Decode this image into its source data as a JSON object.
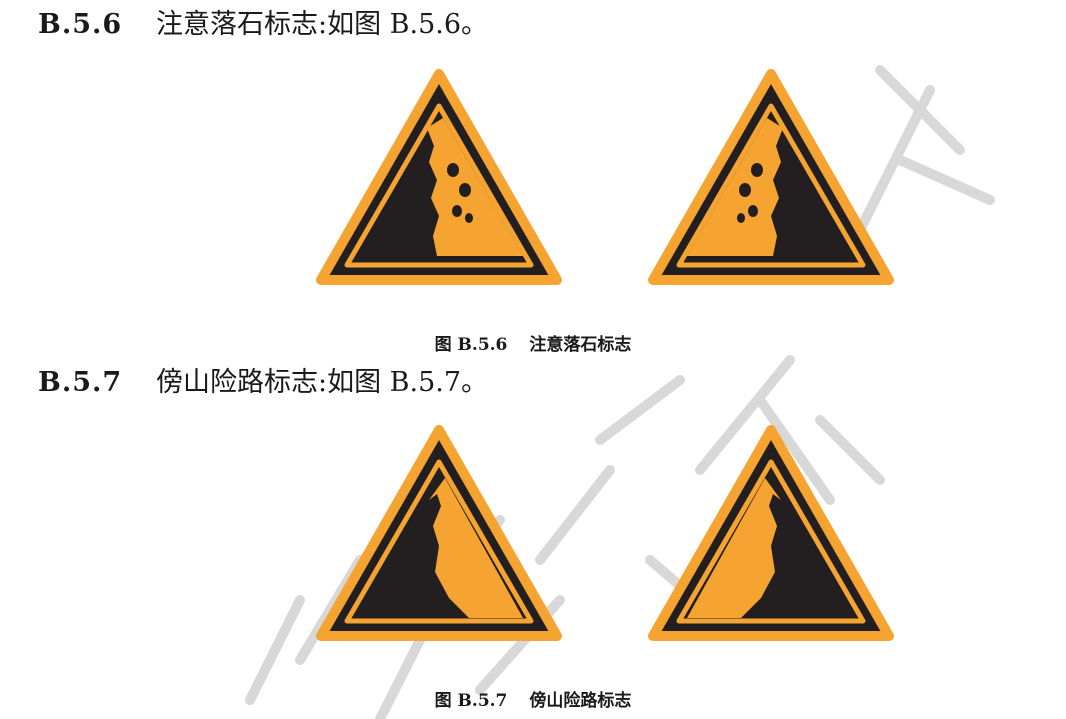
{
  "sections": [
    {
      "number": "B.5.6",
      "text": "注意落石标志:如图 B.5.6。",
      "caption_number": "图 B.5.6",
      "caption_title": "注意落石标志",
      "sign_icons": [
        "falling-rocks-left-sign-icon",
        "falling-rocks-right-sign-icon"
      ]
    },
    {
      "number": "B.5.7",
      "text": "傍山险路标志:如图 B.5.7。",
      "caption_number": "图 B.5.7",
      "caption_title": "傍山险路标志",
      "sign_icons": [
        "mountain-road-left-sign-icon",
        "mountain-road-right-sign-icon"
      ]
    }
  ],
  "colors": {
    "sign_orange": "#f5a431",
    "sign_black": "#231f20",
    "text": "#1a1a1a",
    "watermark": "#cfcfcf"
  }
}
